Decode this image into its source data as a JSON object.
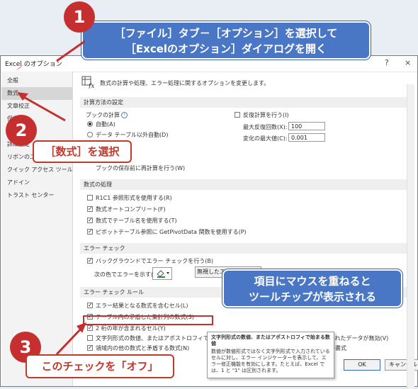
{
  "window": {
    "title": "Excel のオプション",
    "help": "?",
    "close": "×"
  },
  "sidebar": {
    "items": [
      {
        "label": "全般"
      },
      {
        "label": "数式"
      },
      {
        "label": "文章校正"
      },
      {
        "label": "保存"
      },
      {
        "label": "言語"
      },
      {
        "label": "詳細設定"
      },
      {
        "label": "リボンのユーザー設定"
      },
      {
        "label": "クイック アクセス ツール バー"
      },
      {
        "label": "アドイン"
      },
      {
        "label": "トラスト センター"
      }
    ]
  },
  "header": {
    "text": "数式の計算や処理、エラー処理に関するオプションを変更します。"
  },
  "calc": {
    "section": "計算方法の設定",
    "workbook_calc": "ブックの計算",
    "auto": "自動(A)",
    "auto_except_table": "データ テーブル以外自動(D)",
    "recalc_before_save": "ブックの保存前に再計算を行う(W)",
    "iterative": "反復計算を行う(I)",
    "max_iter_label": "最大反復回数(X):",
    "max_iter_value": "100",
    "max_change_label": "変化の最大値(C):",
    "max_change_value": "0.001"
  },
  "formula": {
    "section": "数式の処理",
    "r1c1": "R1C1 参照形式を使用する(R)",
    "autocomplete": "数式オートコンプリート(F)",
    "table_names": "数式でテーブル名を使用する(T)",
    "getpivot": "ピボットテーブル参照に GetPivotData 関数を使用する(P)"
  },
  "errorcheck": {
    "section": "エラー チェック",
    "background": "バックグラウンドでエラー チェックを行う(B)",
    "color_label": "次の色でエラーを示す(E):",
    "reset_button": "無視したエラーのリセット(G)"
  },
  "rules": {
    "section": "エラー チェック ルール",
    "items": [
      {
        "label": "エラー結果となる数式を含むセル(L)",
        "checked": true
      },
      {
        "label": "テーブル内の矛盾した集計列の数式(S)",
        "checked": true
      },
      {
        "label": "2 桁の年が含まれるセル(Y)",
        "checked": true
      },
      {
        "label": "文字列形式の数値、またはアポストロフィで始まる数値(H)",
        "checked": false
      },
      {
        "label": "領域内の他の数式と矛盾する数式(N)",
        "checked": true
      }
    ],
    "right_item_1": "テーブルに入力されたデータが無効(V)",
    "right_item_2": "誤解を招く数値の書式"
  },
  "buttons": {
    "ok": "OK",
    "cancel": "キャンセル"
  },
  "tooltip": {
    "title": "文字列形式の数値、またはアポストロフィで始まる数値",
    "body": "数値が数値形式ではなく文字列形式で入力されているセルに対し、エラー インジケーターを表示して、エラー修正機能を有効にします。たとえば、Excel では、1 と \"1\" は区別されます。"
  },
  "callouts": {
    "step1_line1": "［ファイル］タブ－［オプション］を選択して",
    "step1_line2": "［Excelのオプション］ダイアログを開く",
    "step2": "［数式］を選択",
    "tooltip_line1": "項目にマウスを重ねると",
    "tooltip_line2": "ツールチップが表示される",
    "step3": "このチェックを「オフ」",
    "num1": "1",
    "num2": "2",
    "num3": "3"
  },
  "colors": {
    "accent": "#4a76c6",
    "marker": "#c62f2f"
  }
}
